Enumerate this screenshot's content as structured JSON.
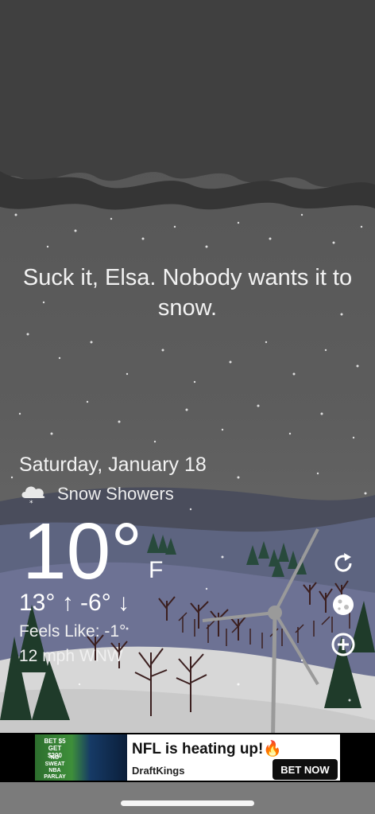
{
  "quote": "Suck it, Elsa. Nobody wants it to snow.",
  "date": "Saturday, January 18",
  "condition": {
    "icon": "snow-cloud-icon",
    "label": "Snow Showers"
  },
  "temperature": {
    "value": "10°",
    "unit": "F"
  },
  "hilo": "13° ↑  -6° ↓",
  "feels_like": "Feels Like: -1°",
  "wind": "12 mph WNW",
  "side_buttons": [
    "refresh-icon",
    "moon-icon",
    "add-icon"
  ],
  "ad": {
    "image_text_1": "BET $5 GET $200",
    "image_text_2": "NO SWEAT NBA PARLAY",
    "title": "NFL is heating up!🔥",
    "brand": "DraftKings",
    "cta": "BET NOW"
  },
  "colors": {
    "accent": "#ffffff",
    "ad_cta": "#0f0f0f"
  }
}
